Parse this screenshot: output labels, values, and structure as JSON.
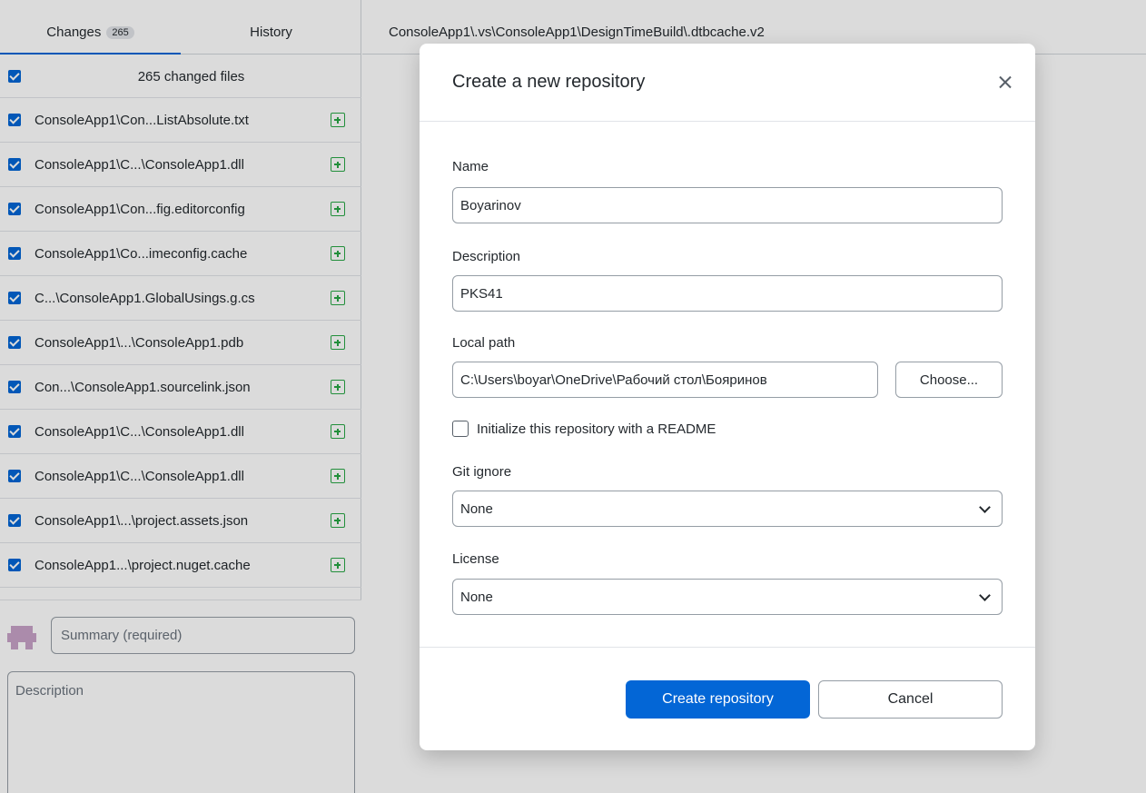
{
  "sidebar": {
    "tabs": [
      {
        "label": "Changes",
        "count": "265"
      },
      {
        "label": "History"
      }
    ],
    "changed_files_label": "265 changed files",
    "files": [
      "ConsoleApp1\\Con...ListAbsolute.txt",
      "ConsoleApp1\\C...\\ConsoleApp1.dll",
      "ConsoleApp1\\Con...fig.editorconfig",
      "ConsoleApp1\\Co...imeconfig.cache",
      "C...\\ConsoleApp1.GlobalUsings.g.cs",
      "ConsoleApp1\\...\\ConsoleApp1.pdb",
      "Con...\\ConsoleApp1.sourcelink.json",
      "ConsoleApp1\\C...\\ConsoleApp1.dll",
      "ConsoleApp1\\C...\\ConsoleApp1.dll",
      "ConsoleApp1\\...\\project.assets.json",
      "ConsoleApp1...\\project.nuget.cache"
    ],
    "summary_placeholder": "Summary (required)",
    "description_placeholder": "Description"
  },
  "main": {
    "path": "ConsoleApp1\\.vs\\ConsoleApp1\\DesignTimeBuild\\.dtbcache.v2",
    "stray_link": "."
  },
  "modal": {
    "title": "Create a new repository",
    "name_label": "Name",
    "name_value": "Boyarinov",
    "description_label": "Description",
    "description_value": "PKS41",
    "local_path_label": "Local path",
    "local_path_value": "C:\\Users\\boyar\\OneDrive\\Рабочий стол\\Бояринов",
    "choose_label": "Choose...",
    "readme_label": "Initialize this repository with a README",
    "gitignore_label": "Git ignore",
    "gitignore_value": "None",
    "license_label": "License",
    "license_value": "None",
    "create_label": "Create repository",
    "cancel_label": "Cancel"
  },
  "colors": {
    "accent": "#0366d6",
    "added": "#28a745"
  }
}
